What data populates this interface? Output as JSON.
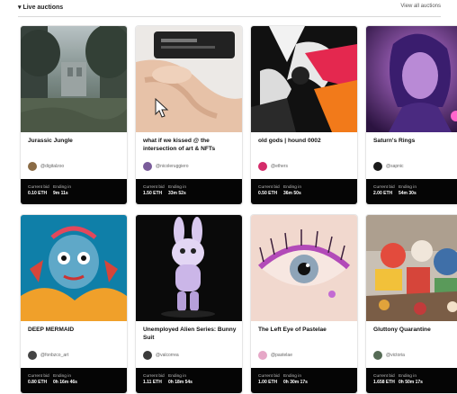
{
  "header": {
    "section_title": "▾ Live auctions",
    "view_all": "View all auctions"
  },
  "cards": [
    {
      "title": "Jurassic Jungle",
      "handle": "@digitalzoo",
      "bid_label": "Current bid",
      "bid": "0.10 ETH",
      "end_label": "Ending in",
      "ending": "9m 11s",
      "avatar_color": "#8a6b45"
    },
    {
      "title": "what if we kissed @ the intersection of art & NFTs",
      "handle": "@nicoleruggiero",
      "bid_label": "Current bid",
      "bid": "1.50 ETH",
      "end_label": "Ending in",
      "ending": "33m 52s",
      "avatar_color": "#7a5c9a"
    },
    {
      "title": "old gods | hound 0002",
      "handle": "@ethers",
      "bid_label": "Current bid",
      "bid": "0.50 ETH",
      "end_label": "Ending in",
      "ending": "36m 50s",
      "avatar_color": "#d42c6a"
    },
    {
      "title": "Saturn's Rings",
      "handle": "@sapnic",
      "bid_label": "Current bid",
      "bid": "2.00 ETH",
      "end_label": "Ending in",
      "ending": "54m 30s",
      "avatar_color": "#1a1a1a"
    },
    {
      "title": "DEEP MERMAID",
      "handle": "@fonbzco_art",
      "bid_label": "Current bid",
      "bid": "0.80 ETH",
      "end_label": "Ending in",
      "ending": "0h 16m 46s",
      "avatar_color": "#444444"
    },
    {
      "title": "Unemployed Alien Series: Bunny Suit",
      "handle": "@valcorrea",
      "bid_label": "Current bid",
      "bid": "1.11 ETH",
      "end_label": "Ending in",
      "ending": "0h 18m 54s",
      "avatar_color": "#3a3a3a"
    },
    {
      "title": "The Left Eye of Pastelae",
      "handle": "@pastelae",
      "bid_label": "Current bid",
      "bid": "1.00 ETH",
      "end_label": "Ending in",
      "ending": "0h 30m 17s",
      "avatar_color": "#e6a7c7"
    },
    {
      "title": "Gluttony Quarantine",
      "handle": "@victoria",
      "bid_label": "Current bid",
      "bid": "1.658 ETH",
      "end_label": "Ending in",
      "ending": "0h 50m 17s",
      "avatar_color": "#556b55"
    }
  ]
}
